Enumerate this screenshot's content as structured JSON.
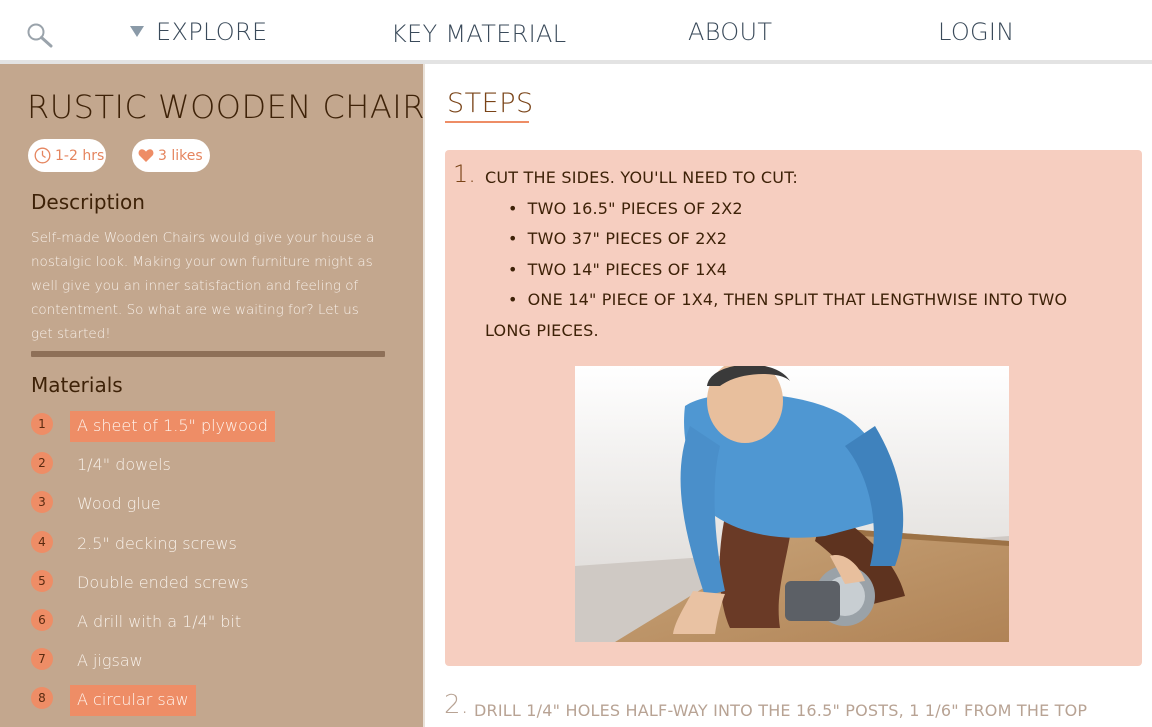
{
  "nav": {
    "explore": "EXPLORE",
    "key_material": "KEY MATERIAL",
    "about": "ABOUT",
    "login": "LOGIN"
  },
  "project": {
    "title": "RUSTIC WOODEN CHAIR",
    "duration": "1-2 hrs",
    "likes": "3 likes",
    "description_heading": "Description",
    "description": "Self-made Wooden Chairs would give your house a nostalgic look. Making your own furniture might as well give you an inner satisfaction and feeling of contentment. So what are we waiting for? Let us get started!",
    "materials_heading": "Materials",
    "materials": [
      {
        "num": "1",
        "label": "A sheet of 1.5\" plywood",
        "highlight": true
      },
      {
        "num": "2",
        "label": "1/4\" dowels",
        "highlight": false
      },
      {
        "num": "3",
        "label": "Wood glue",
        "highlight": false
      },
      {
        "num": "4",
        "label": "2.5\" decking screws",
        "highlight": false
      },
      {
        "num": "5",
        "label": "Double ended screws",
        "highlight": false
      },
      {
        "num": "6",
        "label": "A drill with a 1/4\" bit",
        "highlight": false
      },
      {
        "num": "7",
        "label": "A jigsaw",
        "highlight": false
      },
      {
        "num": "8",
        "label": "A circular saw",
        "highlight": true
      }
    ]
  },
  "steps": {
    "heading": "STEPS",
    "step1": {
      "num": "1.",
      "head": "Cut the sides. You'll need to cut:",
      "bullets": [
        "Two 16.5\" pieces of 2x2",
        "Two 37\" pieces of 2x2",
        "Two 14\" pieces of 1x4",
        "One 14\" piece of 1x4, then split that lengthwise into two"
      ],
      "tail": "long pieces."
    },
    "step2": {
      "num": "2.",
      "text": "Drill 1/4\" holes half-way into the 16.5\" posts, 1 1/6\" from the top"
    }
  },
  "colors": {
    "sidebar": "#c3a78e",
    "accent": "#ee8d66",
    "card": "#f6cec0",
    "title_dark": "#3e2208"
  },
  "icons": {
    "search": "search-icon",
    "explore_caret": "caret-down-icon",
    "clock": "clock-icon",
    "heart": "heart-icon"
  }
}
